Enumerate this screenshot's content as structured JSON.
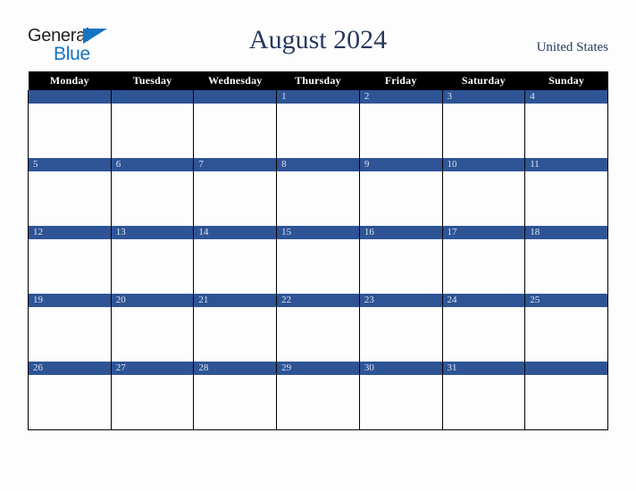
{
  "logo": {
    "line1": "General",
    "line2": "Blue",
    "triangle_color": "#1474c4",
    "text_color": "#231f20"
  },
  "header": {
    "title": "August 2024",
    "country": "United States",
    "title_color": "#27395f"
  },
  "calendar": {
    "weekdays": [
      "Monday",
      "Tuesday",
      "Wednesday",
      "Thursday",
      "Friday",
      "Saturday",
      "Sunday"
    ],
    "header_bg": "#000000",
    "header_text": "#ffffff",
    "daynum_bg": "#2e5496",
    "daynum_text": "#dfe4ee",
    "weeks": [
      [
        "",
        "",
        "",
        "1",
        "2",
        "3",
        "4"
      ],
      [
        "5",
        "6",
        "7",
        "8",
        "9",
        "10",
        "11"
      ],
      [
        "12",
        "13",
        "14",
        "15",
        "16",
        "17",
        "18"
      ],
      [
        "19",
        "20",
        "21",
        "22",
        "23",
        "24",
        "25"
      ],
      [
        "26",
        "27",
        "28",
        "29",
        "30",
        "31",
        ""
      ]
    ]
  }
}
